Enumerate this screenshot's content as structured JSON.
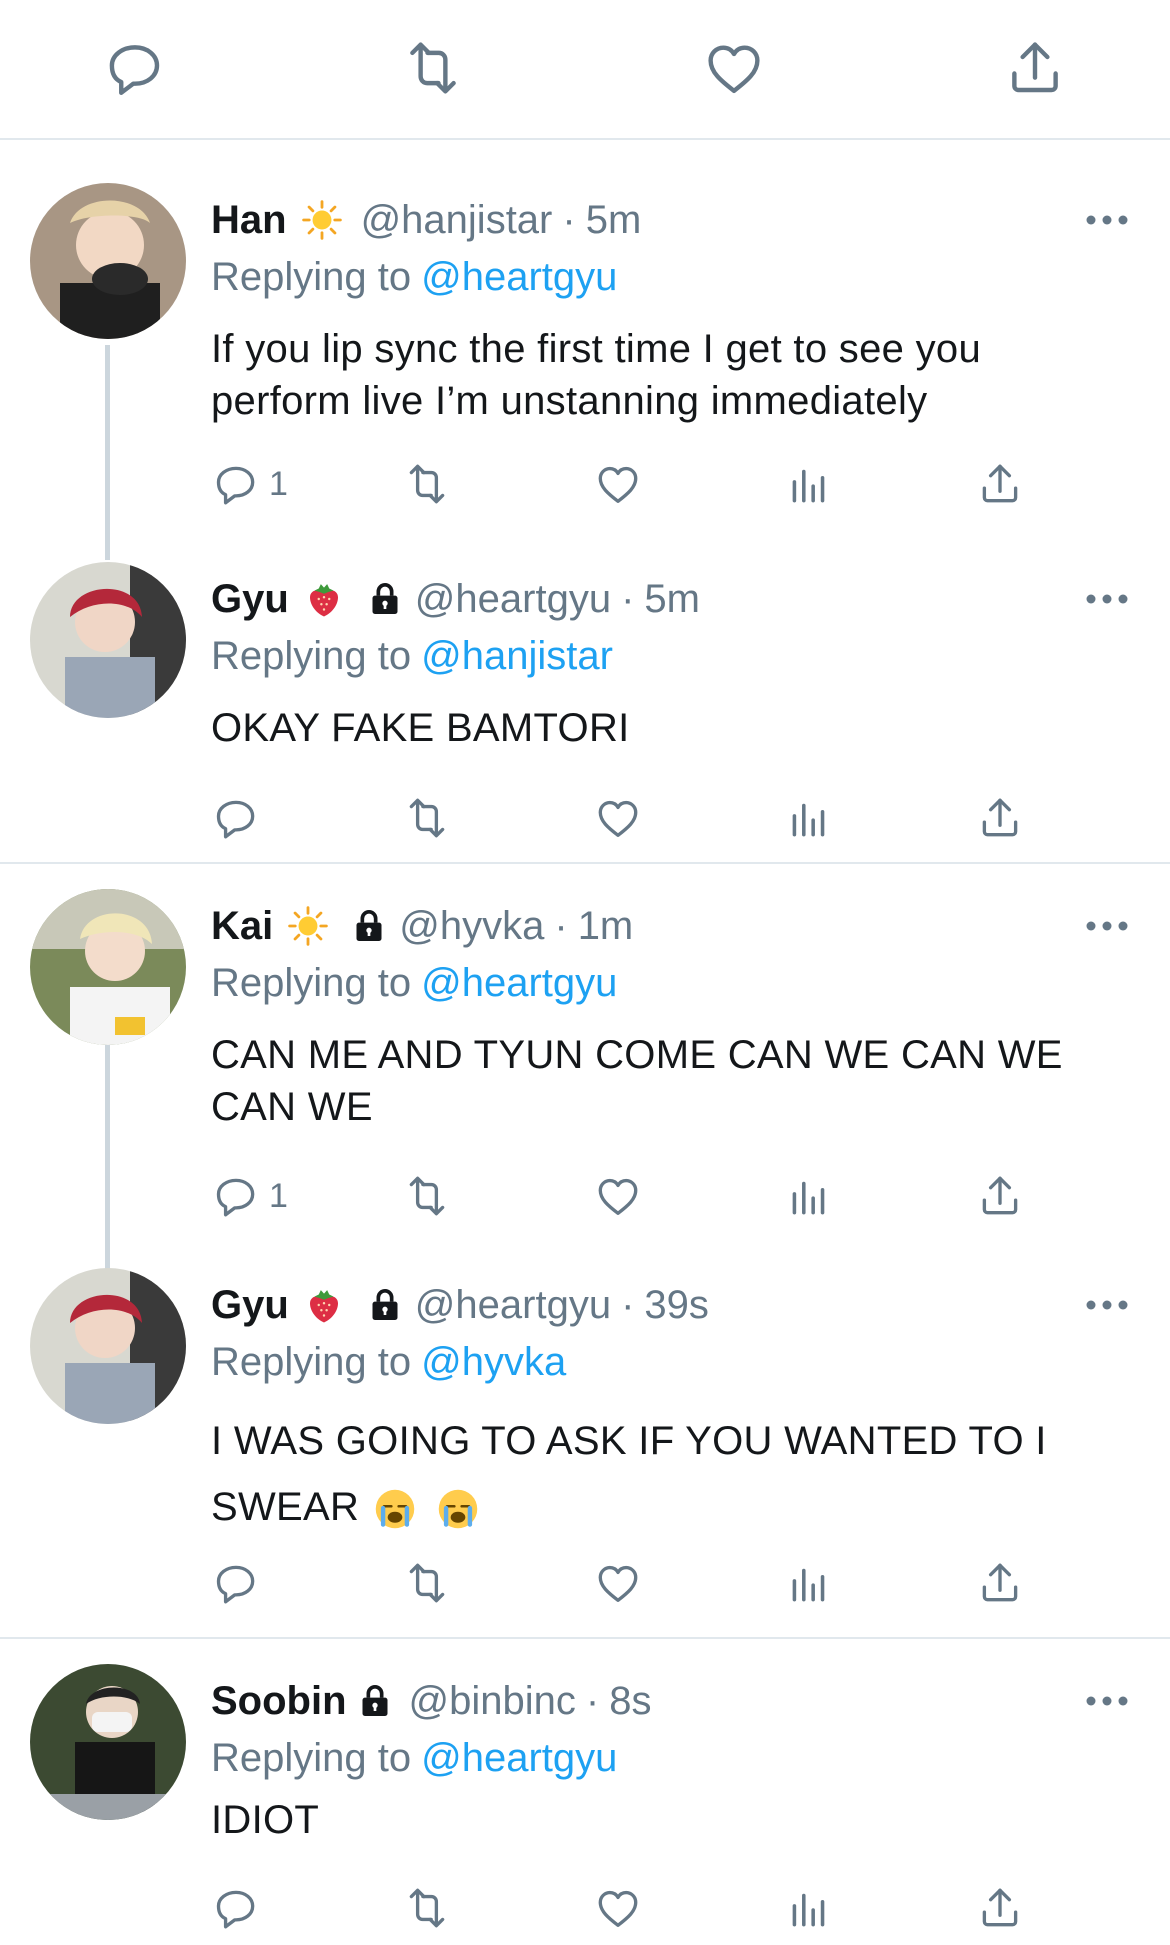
{
  "top_actions": [
    "reply-icon",
    "retweet-icon",
    "like-icon",
    "share-icon"
  ],
  "tweets": [
    {
      "name": "Han",
      "emoji": "sun",
      "locked": false,
      "handle": "@hanjistar",
      "dot": "·",
      "time": "5m",
      "replying_label": "Replying to",
      "replying_to": "@heartgyu",
      "text": "If you lip sync the first time I get to see you perform live I’m unstanning immediately",
      "reply_count": "1"
    },
    {
      "name": "Gyu",
      "emoji": "strawberry",
      "locked": true,
      "handle": "@heartgyu",
      "dot": "·",
      "time": "5m",
      "replying_label": "Replying to",
      "replying_to": "@hanjistar",
      "text": "OKAY FAKE BAMTORI",
      "reply_count": ""
    },
    {
      "name": "Kai",
      "emoji": "sun",
      "locked": true,
      "handle": "@hyvka",
      "dot": "·",
      "time": "1m",
      "replying_label": "Replying to",
      "replying_to": "@heartgyu",
      "text": "CAN ME AND TYUN COME CAN WE CAN WE CAN WE",
      "reply_count": "1"
    },
    {
      "name": "Gyu",
      "emoji": "strawberry",
      "locked": true,
      "handle": "@heartgyu",
      "dot": "·",
      "time": "39s",
      "replying_label": "Replying to",
      "replying_to": "@hyvka",
      "text": "I WAS GOING TO ASK IF YOU WANTED TO I SWEAR",
      "reply_count": ""
    },
    {
      "name": "Soobin",
      "emoji": "",
      "locked": true,
      "handle": "@binbinc",
      "dot": "·",
      "time": "8s",
      "replying_label": "Replying to",
      "replying_to": "@heartgyu",
      "text": "IDIOT",
      "reply_count": ""
    }
  ],
  "colors": {
    "accent": "#1da1f2",
    "muted": "#657786",
    "divider": "#e1e8ed",
    "thread": "#ccd6dd"
  }
}
